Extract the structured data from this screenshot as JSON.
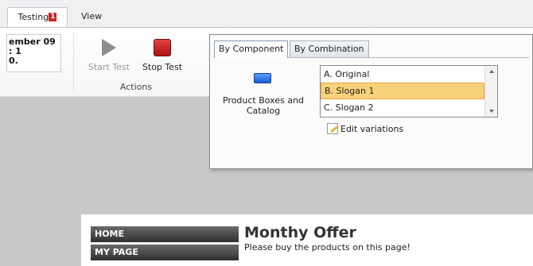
{
  "ribbon_tabs": {
    "testing": "Testing",
    "testing_badge": "1",
    "view": "View"
  },
  "datebox": {
    "line1": "ember 09",
    "line2": ": 1",
    "line3": "0."
  },
  "actions": {
    "start_label": "Start Test",
    "stop_label": "Stop Test",
    "group_label": "Actions"
  },
  "panel": {
    "tabs": [
      "By Component",
      "By Combination"
    ],
    "component_label": "Product Boxes and Catalog",
    "variations": [
      "A. Original",
      "B. Slogan 1",
      "C. Slogan 2"
    ],
    "selected_index": 1,
    "edit_label": "Edit variations"
  },
  "page_preview": {
    "nav": [
      "HOME",
      "MY PAGE"
    ],
    "title": "Monthy Offer",
    "text": "Please buy the products on this page!"
  },
  "colors": {
    "badge": "#d2231d",
    "selection": "#f7d27a",
    "stop_button": "#c41e1e",
    "component_icon": "#2a6fe0"
  }
}
